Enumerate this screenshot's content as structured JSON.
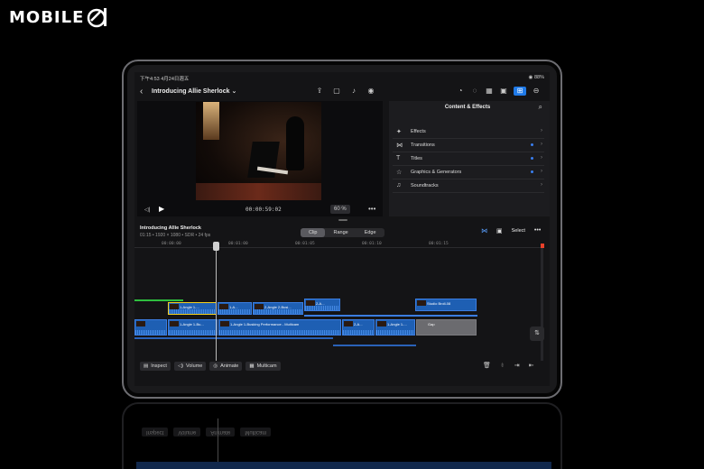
{
  "watermark": {
    "text": "MOBILE"
  },
  "status": {
    "time": "下午4:53  4月24日週五",
    "battery": "◉ 88%"
  },
  "project": {
    "title": "Introducing Allie Sherlock",
    "title_chev": "⌄"
  },
  "viewer": {
    "timecode": "00:00:59:02",
    "zoom": "60 %"
  },
  "panel": {
    "title": "Content & Effects",
    "items": [
      {
        "label": "Effects",
        "icon": "✦",
        "dot": false
      },
      {
        "label": "Transitions",
        "icon": "⋈",
        "dot": true
      },
      {
        "label": "Titles",
        "icon": "T",
        "dot": true
      },
      {
        "label": "Graphics & Generators",
        "icon": "☆",
        "dot": true
      },
      {
        "label": "Soundtracks",
        "icon": "♫",
        "dot": false
      }
    ]
  },
  "timeline": {
    "project_name": "Introducing Allie Sherlock",
    "meta": "01:15 • 1920 × 1080 • SDR • 24 fps",
    "modes": [
      "Clip",
      "Range",
      "Edge"
    ],
    "active_mode": "Clip",
    "select_label": "Select",
    "ruler": [
      "00:00:00",
      "00:01:00",
      "00:01:05",
      "00:01:10",
      "00:01:15"
    ],
    "clips": {
      "upper_angle": "1-Angle 1-...",
      "upper_b": "1-A...",
      "upper_c": "2-Angle 2-Busi...",
      "upper_d": "2-A...",
      "studio_broll": "Studio Broll-08",
      "main_1": "1-Angle 1-Bu...",
      "main_2": "1-Angle 1-Busking Performance - Multicam",
      "main_3": "2-A...",
      "main_4": "1-Angle 1-...",
      "gap": "Gap"
    }
  },
  "bottom": {
    "tools": [
      {
        "icon": "▤",
        "label": "Inspect"
      },
      {
        "icon": "◁)",
        "label": "Volume"
      },
      {
        "icon": "◎",
        "label": "Animate"
      },
      {
        "icon": "▦",
        "label": "Multicam"
      }
    ]
  }
}
